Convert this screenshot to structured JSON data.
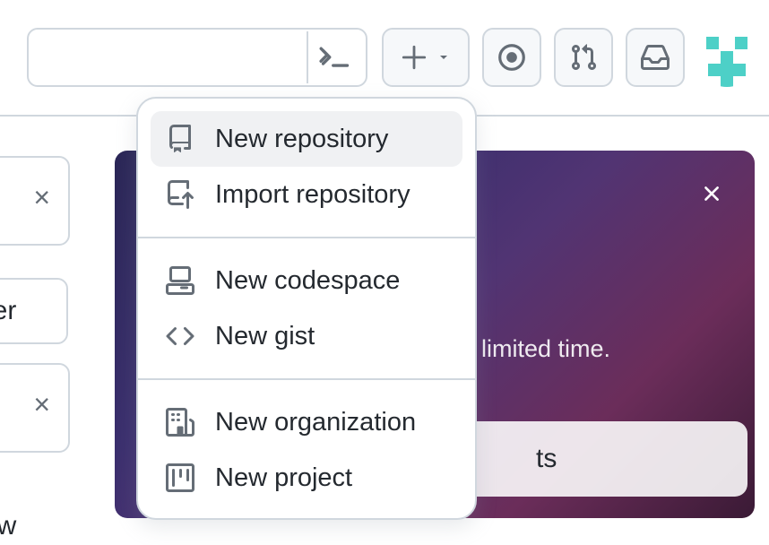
{
  "header": {
    "plus_icon": "plus",
    "caret_icon": "triangle-down",
    "issues_icon": "issue",
    "prs_icon": "git-pull-request",
    "inbox_icon": "inbox",
    "terminal_icon": "terminal"
  },
  "dropdown": {
    "items": {
      "new_repository": "New repository",
      "import_repository": "Import repository",
      "new_codespace": "New codespace",
      "new_gist": "New gist",
      "new_organization": "New organization",
      "new_project": "New project"
    }
  },
  "left_fragments": {
    "x1": "×",
    "filter": "ilter",
    "x2": "×",
    "ow": "ow"
  },
  "banner": {
    "text_fragment": "r a limited time.",
    "button_fragment": "ts",
    "close_icon": "×"
  }
}
